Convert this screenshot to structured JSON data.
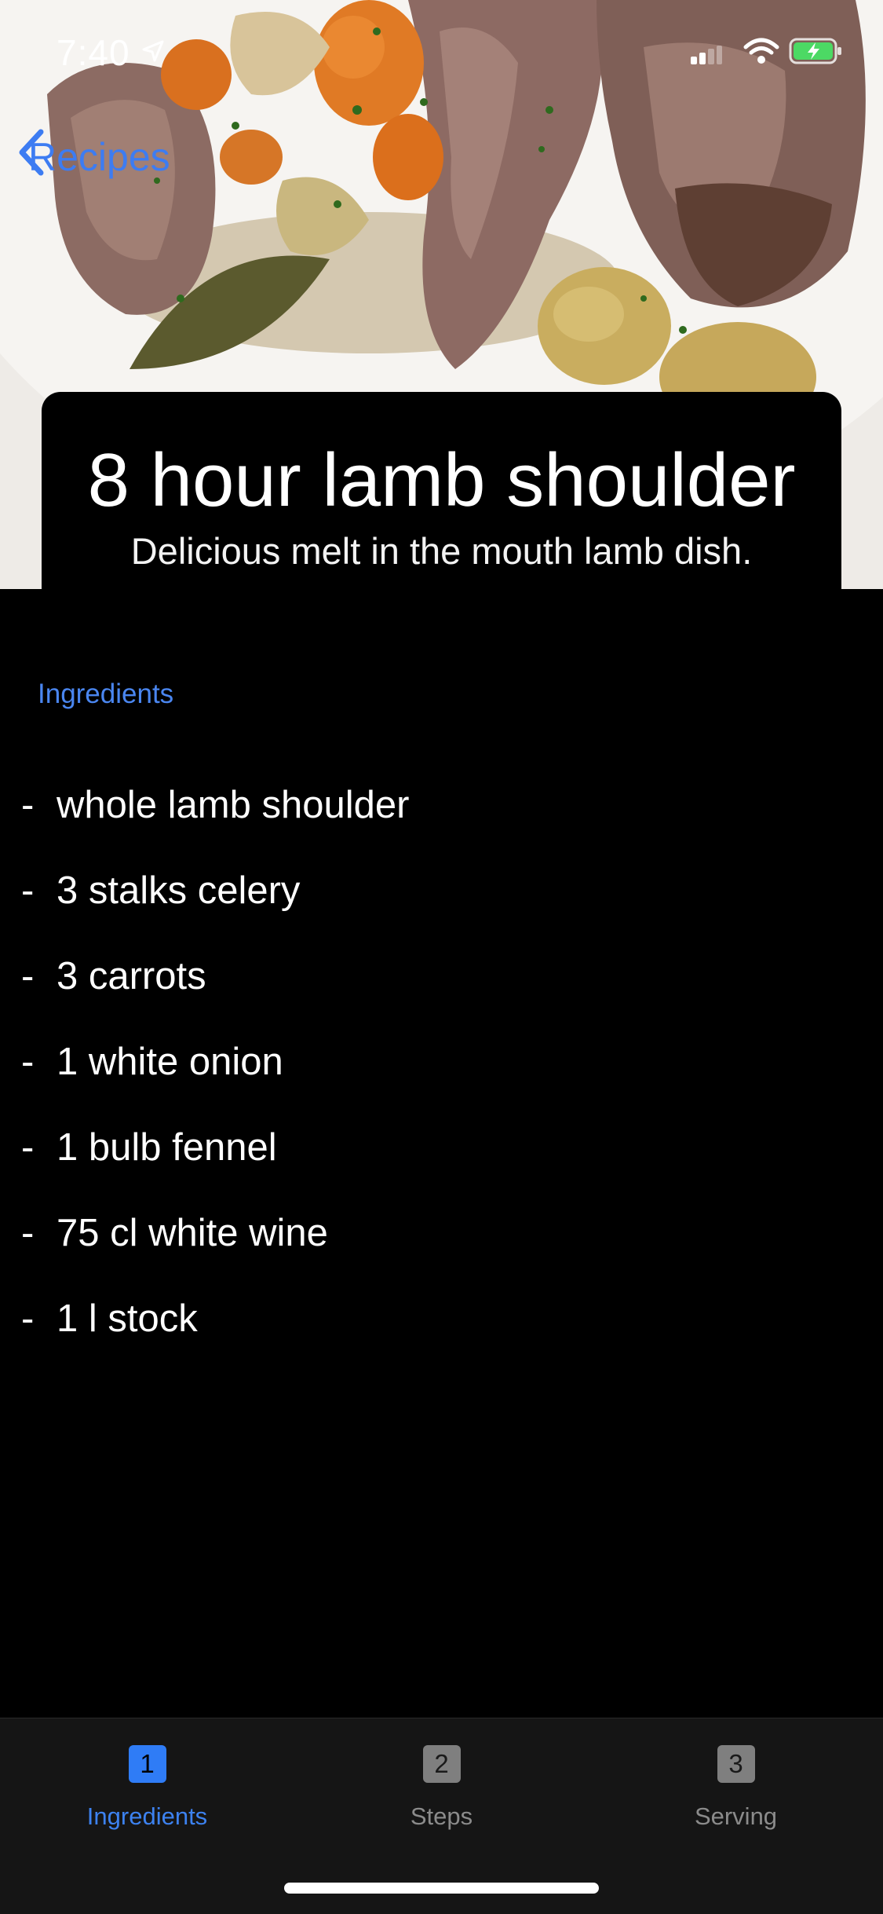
{
  "status_bar": {
    "time": "7:40"
  },
  "nav": {
    "back_label": "Recipes"
  },
  "recipe": {
    "title": "8 hour lamb shoulder",
    "subtitle": "Delicious melt in the mouth lamb dish."
  },
  "section": {
    "label": "Ingredients"
  },
  "ingredients": [
    {
      "dash": "-",
      "text": "whole lamb shoulder"
    },
    {
      "dash": "-",
      "text": "3 stalks celery"
    },
    {
      "dash": "-",
      "text": "3 carrots"
    },
    {
      "dash": "-",
      "text": "1 white onion"
    },
    {
      "dash": "-",
      "text": "1 bulb fennel"
    },
    {
      "dash": "-",
      "text": "75 cl white wine"
    },
    {
      "dash": "-",
      "text": "1 l stock"
    }
  ],
  "tabs": [
    {
      "number": "1",
      "label": "Ingredients",
      "active": true
    },
    {
      "number": "2",
      "label": "Steps",
      "active": false
    },
    {
      "number": "3",
      "label": "Serving",
      "active": false
    }
  ],
  "colors": {
    "accent": "#3d82f0",
    "background": "#000000",
    "tab_bar": "#151515"
  }
}
